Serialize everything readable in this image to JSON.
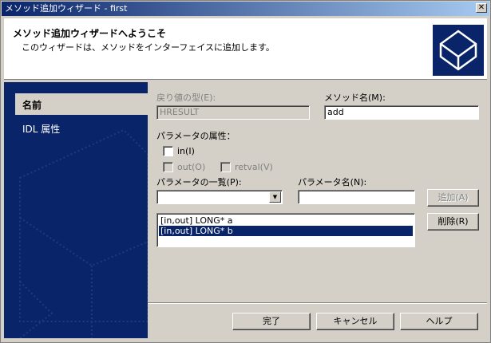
{
  "window": {
    "title": "メソッド追加ウィザード - first",
    "close_glyph": "✕"
  },
  "header": {
    "title": "メソッド追加ウィザードへようこそ",
    "subtitle": "このウィザードは、メソッドをインターフェイスに追加します。",
    "logo_icon": "cube-icon"
  },
  "sidebar": {
    "items": [
      {
        "label": "名前",
        "selected": true
      },
      {
        "label": "IDL 属性",
        "selected": false
      }
    ]
  },
  "form": {
    "return_type_label": "戻り値の型(E):",
    "return_type_value": "HRESULT",
    "method_name_label": "メソッド名(M):",
    "method_name_value": "add",
    "param_attr_label": "パラメータの属性：",
    "in_label": "in(I)",
    "out_label": "out(O)",
    "retval_label": "retval(V)",
    "param_list_label": "パラメータの一覧(P):",
    "param_list_value": "",
    "param_name_label": "パラメータ名(N):",
    "param_name_value": "",
    "add_button": "追加(A)",
    "remove_button": "削除(R)",
    "params": [
      {
        "text": "[in,out] LONG* a",
        "selected": false
      },
      {
        "text": "[in,out] LONG* b",
        "selected": true
      }
    ]
  },
  "footer": {
    "finish": "完了",
    "cancel": "キャンセル",
    "help": "ヘルプ"
  },
  "colors": {
    "titlebar": "#0a246a",
    "sidebar": "#0a246a",
    "face": "#d4d0c8",
    "selection": "#0a246a"
  }
}
